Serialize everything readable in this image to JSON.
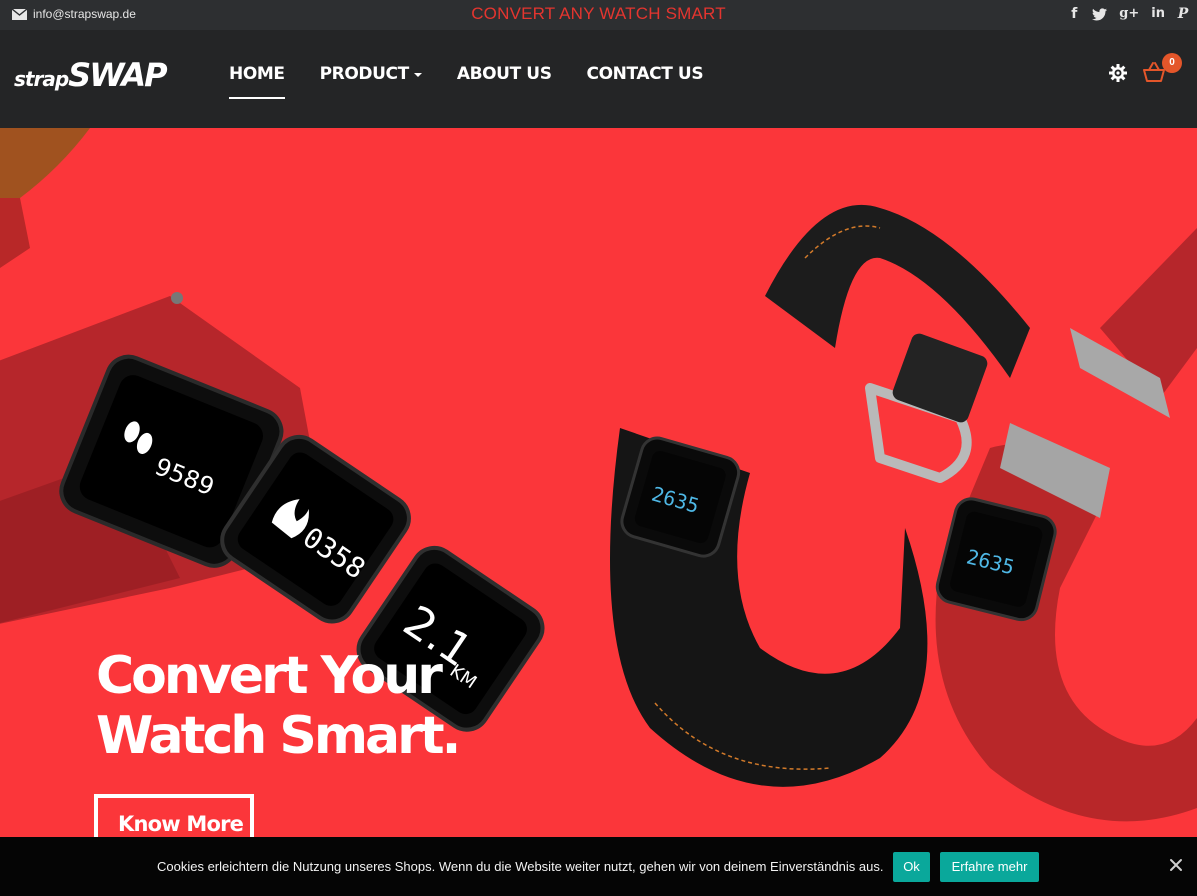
{
  "topbar": {
    "email": "info@strapswap.de",
    "promo": "CONVERT ANY WATCH SMART",
    "socials": [
      {
        "icon": "facebook-icon",
        "glyph": "f"
      },
      {
        "icon": "twitter-icon",
        "glyph": "🐦"
      },
      {
        "icon": "google-plus-icon",
        "glyph": "g+"
      },
      {
        "icon": "linkedin-icon",
        "glyph": "in"
      },
      {
        "icon": "pinterest-icon",
        "glyph": "P"
      }
    ]
  },
  "header": {
    "logo_part1": "strap",
    "logo_part2": "SWAP",
    "nav": [
      {
        "label": "HOME",
        "active": true
      },
      {
        "label": "PRODUCT",
        "dropdown": true
      },
      {
        "label": "ABOUT US"
      },
      {
        "label": "CONTACT US"
      }
    ],
    "cart_count": "0"
  },
  "hero": {
    "headline_line1": "Convert Your",
    "headline_line2": "Watch Smart.",
    "cta": "Know More",
    "display_steps": "9589",
    "display_calories": "0358",
    "display_distance": "2.1",
    "display_distance_unit": "KM",
    "display_time": "2635"
  },
  "cookie": {
    "message": "Cookies erleichtern die Nutzung unseres Shops. Wenn du die Website weiter nutzt, gehen wir von deinem Einverständnis aus.",
    "ok": "Ok",
    "more": "Erfahre mehr"
  },
  "colors": {
    "hero_red": "#fb363a",
    "topbar": "#2d2f31",
    "header": "#242526",
    "accent_teal": "#0aa89b",
    "badge_orange": "#e4562a"
  }
}
